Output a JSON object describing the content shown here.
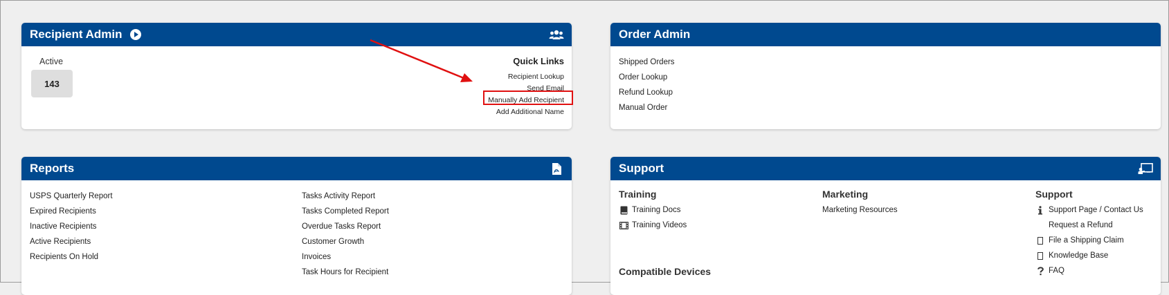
{
  "recipient_admin": {
    "title": "Recipient Admin",
    "active_label": "Active",
    "active_count": "143",
    "quick_links_title": "Quick Links",
    "quick_links": [
      "Recipient Lookup",
      "Send Email",
      "Manually Add Recipient",
      "Add Additional Name"
    ]
  },
  "order_admin": {
    "title": "Order Admin",
    "links": [
      "Shipped Orders",
      "Order Lookup",
      "Refund Lookup",
      "Manual Order"
    ]
  },
  "reports": {
    "title": "Reports",
    "left_links": [
      "USPS Quarterly Report",
      "Expired Recipients",
      "Inactive Recipients",
      "Active Recipients",
      "Recipients On Hold"
    ],
    "right_links": [
      "Tasks Activity Report",
      "Tasks Completed Report",
      "Overdue Tasks Report",
      "Customer Growth",
      "Invoices",
      "Task Hours for Recipient"
    ]
  },
  "support": {
    "title": "Support",
    "training_title": "Training",
    "training_links": [
      "Training Docs",
      "Training Videos"
    ],
    "marketing_title": "Marketing",
    "marketing_links": [
      "Marketing Resources"
    ],
    "support_title": "Support",
    "support_links": [
      "Support Page / Contact Us",
      "Request a Refund",
      "File a Shipping Claim",
      "Knowledge Base",
      "FAQ"
    ],
    "devices_title": "Compatible Devices"
  },
  "colors": {
    "header": "#00498f",
    "annotation": "#e01010"
  }
}
